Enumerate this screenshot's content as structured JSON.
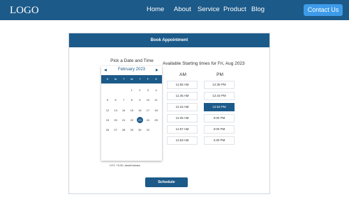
{
  "nav": {
    "logo": "LOGO",
    "links": [
      "Home",
      "About",
      "Service",
      "Product",
      "Blog"
    ],
    "contact_label": "Contact Us"
  },
  "booking": {
    "header": "Book Appointment",
    "pick_title": "Pick a Date and Time",
    "slots_title": "Available Starting times for Fri, Aug 2023",
    "am_label": "AM",
    "pm_label": "PM",
    "schedule_label": "Schedule",
    "timezone_note": "UTC +5:30, Asia/Kolkata"
  },
  "calendar": {
    "month": "February 2023",
    "prev_icon": "◀",
    "next_icon": "▶",
    "weekdays": [
      "S",
      "M",
      "T",
      "W",
      "T",
      "F",
      "S"
    ],
    "days": [
      "1",
      "2",
      "3",
      "4",
      "5",
      "6",
      "7",
      "8",
      "9",
      "10",
      "11",
      "12",
      "13",
      "14",
      "15",
      "16",
      "17",
      "18",
      "19",
      "20",
      "21",
      "22",
      "23",
      "24",
      "25",
      "26",
      "27",
      "28",
      "29",
      "30",
      "31"
    ],
    "selected_day": "23"
  },
  "slots": {
    "am": [
      "11:55 AM",
      "11:45 AM",
      "11:15 AM",
      "11:25 AM",
      "11:57 AM",
      "11:53 AM"
    ],
    "pm": [
      "12:35 PM",
      "12:43 PM",
      "12:53 PM",
      "3:00 PM",
      "3:00 PM",
      "4:30 PM"
    ],
    "selected_pm": "12:53 PM"
  },
  "colors": {
    "brand": "#1c5a89",
    "accent": "#3d9be9"
  }
}
